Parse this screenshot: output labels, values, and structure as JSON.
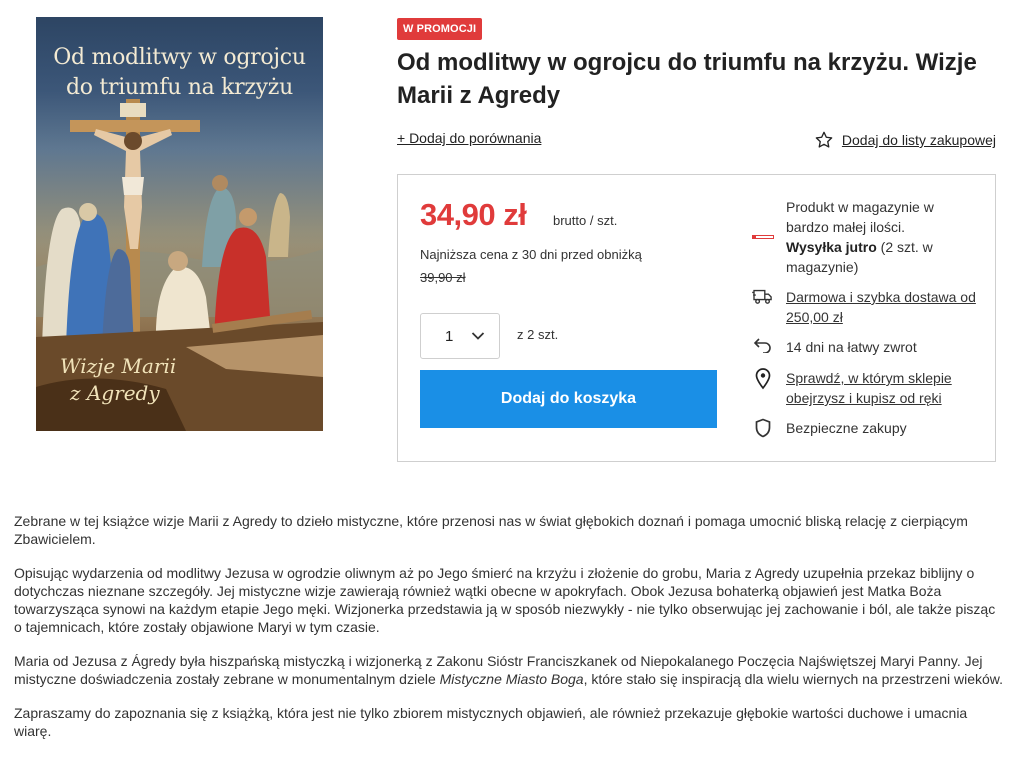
{
  "cover": {
    "title_line1": "Od modlitwy w ogrojcu",
    "title_line2": "do triumfu na krzyżu",
    "subtitle_line1": "Wizje Marii",
    "subtitle_line2": "z Agredy"
  },
  "product": {
    "badge": "W PROMOCJI",
    "title": "Od modlitwy w ogrojcu do triumfu na krzyżu. Wizje Marii z Agredy",
    "compare_label": "+ Dodaj do porównania",
    "wishlist_label": "Dodaj do listy zakupowej"
  },
  "purchase": {
    "price": "34,90 zł",
    "price_unit": "brutto / szt.",
    "lowest_price_label": "Najniższa cena z 30 dni przed obniżką",
    "old_price": "39,90 zł",
    "quantity_value": "1",
    "quantity_of": "z 2 szt.",
    "add_to_cart_label": "Dodaj do koszyka"
  },
  "availability": {
    "stock_text": "Produkt w magazynie w bardzo małej ilości.",
    "shipping_bold": "Wysyłka jutro",
    "shipping_rest": " (2 szt. w magazynie)",
    "features": [
      {
        "icon": "truck-icon",
        "text": "Darmowa i szybka dostawa od 250,00 zł"
      },
      {
        "icon": "return-arrow-icon",
        "text": "14 dni na łatwy zwrot"
      },
      {
        "icon": "map-pin-icon",
        "text": "Sprawdź, w którym sklepie obejrzysz i kupisz od ręki"
      },
      {
        "icon": "shield-icon",
        "text": "Bezpieczne zakupy"
      }
    ]
  },
  "description": {
    "p1": "Zebrane w tej książce wizje Marii z Agredy to dzieło mistyczne, które przenosi nas w świat głębokich doznań i pomaga umocnić bliską relację z cierpiącym Zbawicielem.",
    "p2": "Opisując wydarzenia od modlitwy Jezusa w ogrodzie oliwnym aż po Jego śmierć na krzyżu i złożenie do grobu, Maria z Agredy uzupełnia przekaz biblijny o dotychczas nieznane szczegóły. Jej mistyczne wizje zawierają również wątki obecne w apokryfach. Obok Jezusa bohaterką objawień jest   Matka Boża towarzysząca synowi na każdym etapie Jego męki. Wizjonerka przedstawia ją  w sposób niezwykły - nie tylko obserwując jej zachowanie i ból, ale także pisząc o tajemnicach, które zostały objawione Maryi w tym czasie.",
    "p3_before": "Maria od Jezusa z Ágredy była hiszpańską mistyczką i wizjonerką z Zakonu Sióstr Franciszkanek od Niepokalanego Poczęcia Najświętszej Maryi Panny. Jej mistyczne doświadczenia zostały zebrane w monumentalnym dziele ",
    "p3_italic": "Mistyczne Miasto Boga",
    "p3_after": ", które stało się inspiracją dla wielu wiernych na przestrzeni wieków.",
    "p4": "Zapraszamy do zapoznania się z książką, która jest nie tylko zbiorem mistycznych objawień, ale również przekazuje głębokie wartości duchowe i umacnia wiarę."
  },
  "colors": {
    "accent_red": "#e03b3b",
    "button_blue": "#1a8fe6"
  }
}
